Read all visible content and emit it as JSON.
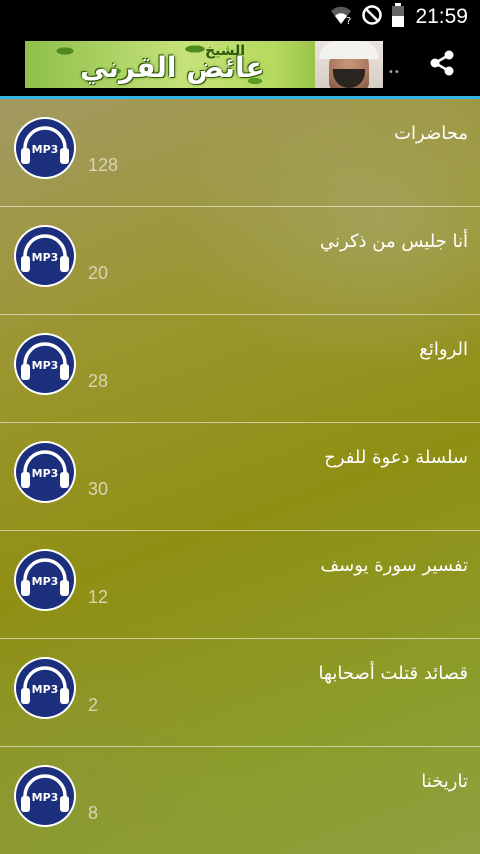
{
  "status_bar": {
    "time": "21:59",
    "icons": [
      "wifi-question-icon",
      "no-signal-icon",
      "battery-icon"
    ]
  },
  "action_bar": {
    "banner": {
      "subtitle": "الشيخ",
      "title": "عائض القرني"
    },
    "share_icon": "share-icon"
  },
  "list": {
    "items": [
      {
        "label": "محاضرات",
        "count": "128",
        "icon": "mp3-headphones-icon"
      },
      {
        "label": "أنا جليس من ذكرني",
        "count": "20",
        "icon": "mp3-headphones-icon"
      },
      {
        "label": "الروائع",
        "count": "28",
        "icon": "mp3-headphones-icon"
      },
      {
        "label": "سلسلة دعوة للفرح",
        "count": "30",
        "icon": "mp3-headphones-icon"
      },
      {
        "label": "تفسير سورة يوسف",
        "count": "12",
        "icon": "mp3-headphones-icon"
      },
      {
        "label": "قصائد قتلت أصحابها",
        "count": "2",
        "icon": "mp3-headphones-icon"
      },
      {
        "label": "تاريخنا",
        "count": "8",
        "icon": "mp3-headphones-icon"
      }
    ]
  },
  "colors": {
    "accent_line": "#33b5e5",
    "icon_navy": "#1b2f7c",
    "list_bg": "#9a962e"
  }
}
